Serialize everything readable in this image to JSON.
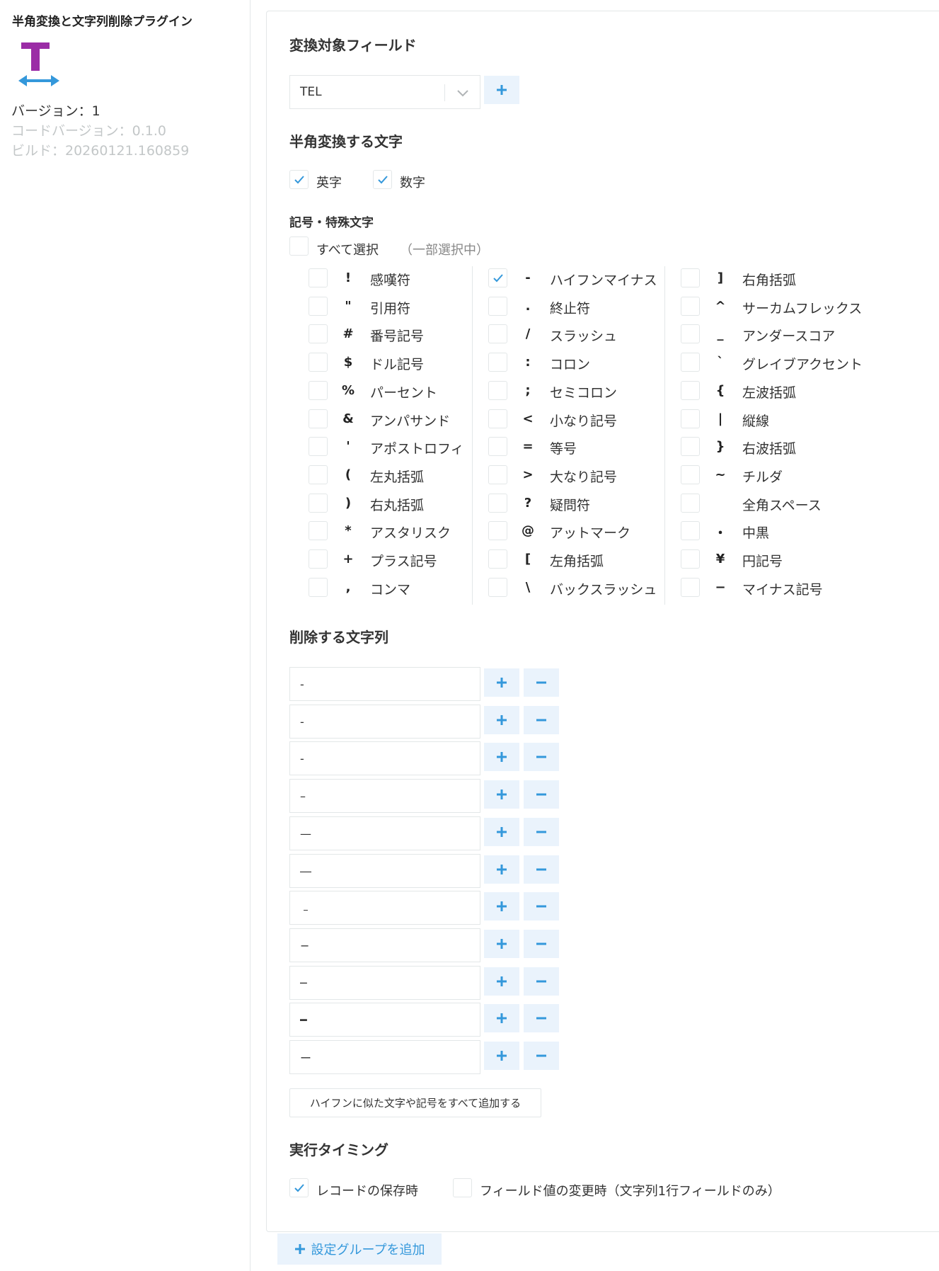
{
  "sidebar": {
    "plugin_title": "半角変換と文字列削除プラグイン",
    "icon": "text-width-icon",
    "version": "バージョン：1",
    "code_version": "コードバージョン：0.1.0",
    "build": "ビルド：20260121.160859"
  },
  "colors": {
    "accent": "#3498db",
    "icon_t": "#9b2ca6",
    "button_bg": "#eaf3fc",
    "border": "#e3e7e8"
  },
  "target_field": {
    "title": "変換対象フィールド",
    "selected": "TEL"
  },
  "halfwidth": {
    "title": "半角変換する文字",
    "alpha_label": "英字",
    "alpha_checked": true,
    "digit_label": "数字",
    "digit_checked": true
  },
  "symbols": {
    "title": "記号・特殊文字",
    "select_all_label": "すべて選択",
    "partial_note": "（一部選択中）",
    "columns": [
      [
        {
          "sym": "!",
          "name": "感嘆符",
          "checked": false
        },
        {
          "sym": "\"",
          "name": "引用符",
          "checked": false
        },
        {
          "sym": "#",
          "name": "番号記号",
          "checked": false
        },
        {
          "sym": "$",
          "name": "ドル記号",
          "checked": false
        },
        {
          "sym": "%",
          "name": "パーセント",
          "checked": false
        },
        {
          "sym": "&",
          "name": "アンパサンド",
          "checked": false
        },
        {
          "sym": "'",
          "name": "アポストロフィ",
          "checked": false
        },
        {
          "sym": "(",
          "name": "左丸括弧",
          "checked": false
        },
        {
          "sym": ")",
          "name": "右丸括弧",
          "checked": false
        },
        {
          "sym": "*",
          "name": "アスタリスク",
          "checked": false
        },
        {
          "sym": "+",
          "name": "プラス記号",
          "checked": false
        },
        {
          "sym": ",",
          "name": "コンマ",
          "checked": false
        }
      ],
      [
        {
          "sym": "-",
          "name": "ハイフンマイナス",
          "checked": true
        },
        {
          "sym": ".",
          "name": "終止符",
          "checked": false
        },
        {
          "sym": "/",
          "name": "スラッシュ",
          "checked": false
        },
        {
          "sym": ":",
          "name": "コロン",
          "checked": false
        },
        {
          "sym": ";",
          "name": "セミコロン",
          "checked": false
        },
        {
          "sym": "<",
          "name": "小なり記号",
          "checked": false
        },
        {
          "sym": "=",
          "name": "等号",
          "checked": false
        },
        {
          "sym": ">",
          "name": "大なり記号",
          "checked": false
        },
        {
          "sym": "?",
          "name": "疑問符",
          "checked": false
        },
        {
          "sym": "@",
          "name": "アットマーク",
          "checked": false
        },
        {
          "sym": "[",
          "name": "左角括弧",
          "checked": false
        },
        {
          "sym": "\\",
          "name": "バックスラッシュ",
          "checked": false
        }
      ],
      [
        {
          "sym": "]",
          "name": "右角括弧",
          "checked": false
        },
        {
          "sym": "^",
          "name": "サーカムフレックス",
          "checked": false
        },
        {
          "sym": "_",
          "name": "アンダースコア",
          "checked": false
        },
        {
          "sym": "`",
          "name": "グレイブアクセント",
          "checked": false
        },
        {
          "sym": "{",
          "name": "左波括弧",
          "checked": false
        },
        {
          "sym": "|",
          "name": "縦線",
          "checked": false
        },
        {
          "sym": "}",
          "name": "右波括弧",
          "checked": false
        },
        {
          "sym": "~",
          "name": "チルダ",
          "checked": false
        },
        {
          "sym": "",
          "name": "全角スペース",
          "checked": false
        },
        {
          "sym": "・",
          "name": "中黒",
          "checked": false
        },
        {
          "sym": "¥",
          "name": "円記号",
          "checked": false
        },
        {
          "sym": "−",
          "name": "マイナス記号",
          "checked": false
        }
      ]
    ]
  },
  "delete_strings": {
    "title": "削除する文字列",
    "values": [
      "-",
      "‐",
      "‑",
      "–",
      "—",
      "―",
      "﹣",
      "−",
      "─",
      "━",
      "ー"
    ],
    "add_similar_label": "ハイフンに似た文字や記号をすべて追加する"
  },
  "timing": {
    "title": "実行タイミング",
    "on_save_label": "レコードの保存時",
    "on_save_checked": true,
    "on_change_label": "フィールド値の変更時（文字列1行フィールドのみ）",
    "on_change_checked": false
  },
  "add_group_label": "設定グループを追加"
}
